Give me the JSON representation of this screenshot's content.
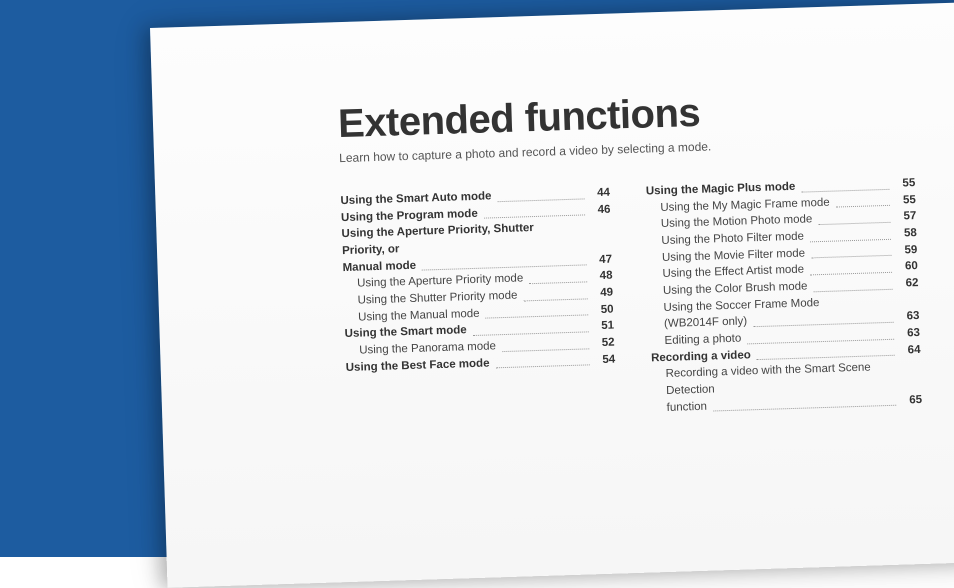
{
  "title": "Extended functions",
  "subtitle": "Learn how to capture a photo and record a video by selecting a mode.",
  "toc": {
    "left": [
      {
        "label": "Using the Smart Auto mode",
        "page": "44",
        "bold": true,
        "sub": false
      },
      {
        "label": "Using the Program mode",
        "page": "46",
        "bold": true,
        "sub": false
      },
      {
        "label": "Using the Aperture Priority, Shutter Priority, or",
        "page": "",
        "bold": true,
        "sub": false,
        "noleader": true
      },
      {
        "label": "Manual mode",
        "page": "47",
        "bold": true,
        "sub": false
      },
      {
        "label": "Using the Aperture Priority mode",
        "page": "48",
        "bold": false,
        "sub": true
      },
      {
        "label": "Using the Shutter Priority mode",
        "page": "49",
        "bold": false,
        "sub": true
      },
      {
        "label": "Using the Manual mode",
        "page": "50",
        "bold": false,
        "sub": true
      },
      {
        "label": "Using the Smart mode",
        "page": "51",
        "bold": true,
        "sub": false
      },
      {
        "label": "Using the Panorama mode",
        "page": "52",
        "bold": false,
        "sub": true
      },
      {
        "label": "Using the Best Face mode",
        "page": "54",
        "bold": true,
        "sub": false
      }
    ],
    "right": [
      {
        "label": "Using the Magic Plus mode",
        "page": "55",
        "bold": true,
        "sub": false
      },
      {
        "label": "Using the My Magic Frame mode",
        "page": "55",
        "bold": false,
        "sub": true
      },
      {
        "label": "Using the Motion Photo mode",
        "page": "57",
        "bold": false,
        "sub": true
      },
      {
        "label": "Using the Photo Filter mode",
        "page": "58",
        "bold": false,
        "sub": true
      },
      {
        "label": "Using the Movie Filter mode",
        "page": "59",
        "bold": false,
        "sub": true
      },
      {
        "label": "Using the Effect Artist mode",
        "page": "60",
        "bold": false,
        "sub": true
      },
      {
        "label": "Using the Color Brush mode",
        "page": "62",
        "bold": false,
        "sub": true
      },
      {
        "label": "Using the Soccer Frame Mode",
        "page": "",
        "bold": false,
        "sub": true,
        "noleader": true
      },
      {
        "label": "(WB2014F only)",
        "page": "63",
        "bold": false,
        "sub": true
      },
      {
        "label": "Editing a photo",
        "page": "63",
        "bold": false,
        "sub": true
      },
      {
        "label": "Recording a video",
        "page": "64",
        "bold": true,
        "sub": false
      },
      {
        "label": "Recording a video with the Smart Scene Detection",
        "page": "",
        "bold": false,
        "sub": true,
        "noleader": true
      },
      {
        "label": "function",
        "page": "65",
        "bold": false,
        "sub": true
      }
    ]
  }
}
